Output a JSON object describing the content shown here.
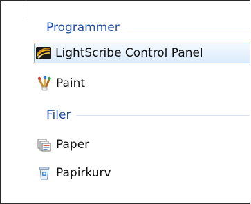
{
  "groups": [
    {
      "label": "Programmer",
      "items": [
        {
          "label": "LightScribe Control Panel",
          "icon": "lightscribe-icon",
          "selected": true
        },
        {
          "label": "Paint",
          "icon": "paint-brushes-icon",
          "selected": false
        }
      ]
    },
    {
      "label": "Filer",
      "items": [
        {
          "label": "Paper",
          "icon": "folder-files-icon",
          "selected": false
        },
        {
          "label": "Papirkurv",
          "icon": "recycle-bin-icon",
          "selected": false
        }
      ]
    }
  ],
  "colors": {
    "group_header": "#1e4fa8",
    "selection_border": "#7da2ce",
    "selection_fill": "#dcebfc"
  }
}
